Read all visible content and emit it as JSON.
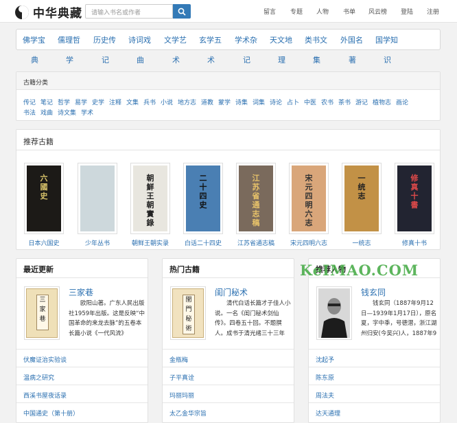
{
  "header": {
    "site_name": "中华典藏",
    "search_placeholder": "请输入书名或作者",
    "nav": [
      "留言",
      "专题",
      "人物",
      "书单",
      "风云榜",
      "登陆",
      "注册"
    ]
  },
  "categories": {
    "top": [
      "佛学宝",
      "儒理哲",
      "历史传",
      "诗词戏",
      "文学艺",
      "玄学五",
      "学术杂",
      "天文地",
      "类书文",
      "外国名",
      "国学知"
    ],
    "sub": [
      "典",
      "学",
      "记",
      "曲",
      "术",
      "术",
      "记",
      "理",
      "集",
      "著",
      "识"
    ]
  },
  "ancient": {
    "heading": "古籍分类",
    "tags": [
      "传记",
      "笔记",
      "哲学",
      "易学",
      "史学",
      "注释",
      "文集",
      "兵书",
      "小说",
      "地方志",
      "道教",
      "蒙学",
      "诗集",
      "词集",
      "诗论",
      "占卜",
      "中医",
      "农书",
      "茶书",
      "游记",
      "植物志",
      "画论",
      "书法",
      "戏曲",
      "诗文集",
      "学术"
    ]
  },
  "recommended": {
    "heading": "推荐古籍",
    "books": [
      {
        "title": "日本六国史",
        "cover_text": "六國史",
        "bg": "#1c1a17",
        "fg": "#d8c36a"
      },
      {
        "title": "少年丛书",
        "cover_text": "",
        "bg": "#cdd8dc",
        "fg": "#333"
      },
      {
        "title": "朝鲜王朝实录",
        "cover_text": "朝鮮王朝實錄",
        "bg": "#e8e6df",
        "fg": "#222"
      },
      {
        "title": "白话二十四史",
        "cover_text": "二十四史",
        "bg": "#4a7fb3",
        "fg": "#111"
      },
      {
        "title": "江苏省通志稿",
        "cover_text": "江苏省通志稿",
        "bg": "#7a6a5c",
        "fg": "#e8c36a"
      },
      {
        "title": "宋元四明六志",
        "cover_text": "宋元四明六志",
        "bg": "#d9a67a",
        "fg": "#333"
      },
      {
        "title": "一统志",
        "cover_text": "一统志",
        "bg": "#c29146",
        "fg": "#222"
      },
      {
        "title": "修真十书",
        "cover_text": "修真十書",
        "bg": "#222431",
        "fg": "#e14a4a"
      }
    ]
  },
  "latest": {
    "heading": "最近更新",
    "feature_title": "三家巷",
    "feature_thumb_text": "三家巷",
    "feature_desc": "欧阳山著。广东人民出版社1959年出版。这是反映“中国革命的来龙去脉”的五卷本长篇小说《一代风流》",
    "items": [
      "伏魔证治实验谈",
      "温病之研究",
      "西溪书屋夜话录",
      "中国通史（第十册）"
    ]
  },
  "hot": {
    "heading": "热门古籍",
    "feature_title": "闺门秘术",
    "feature_thumb_text": "閨門秘術",
    "feature_desc": "清代白话长篇才子佳人小说。一名《闺门秘术剑仙传》。四卷五十回。不题撰人。成书于清光绪三十三年",
    "items": [
      "金瓶梅",
      "子平真诠",
      "玛丽玛丽",
      "太乙金华宗旨"
    ]
  },
  "people": {
    "heading": "推荐人物",
    "watermark": "KeIMAO.COM",
    "feature_title": "钱玄同",
    "feature_desc": "钱玄同（1887年9月12日—1939年1月17日），原名夏，字中季，号德潜，浙江湖州归安(今吴兴)人，1887年9",
    "items": [
      "沈起予",
      "陈东原",
      "周法夫",
      "达天通理"
    ]
  },
  "colors": {
    "accent": "#337ab7",
    "link": "#2a6fb0"
  }
}
